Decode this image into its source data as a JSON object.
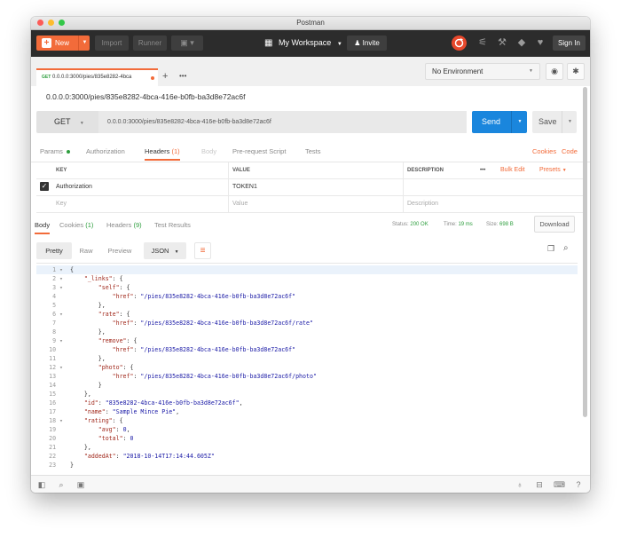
{
  "window": {
    "title": "Postman"
  },
  "header": {
    "new_label": "New",
    "import_label": "Import",
    "runner_label": "Runner",
    "workspace_label": "My Workspace",
    "invite_label": "Invite",
    "signin_label": "Sign In",
    "icons": [
      "sync-icon",
      "satellite-icon",
      "wrench-icon",
      "bell-icon",
      "heart-icon"
    ]
  },
  "request_tab": {
    "method": "GET",
    "label": "0.0.0.0:3000/pies/835e8282-4bca"
  },
  "environment": {
    "selected": "No Environment"
  },
  "request": {
    "title": "0.0.0.0:3000/pies/835e8282-4bca-416e-b0fb-ba3d8e72ac6f",
    "method": "GET",
    "url": "0.0.0.0:3000/pies/835e8282-4bca-416e-b0fb-ba3d8e72ac6f",
    "send_label": "Send",
    "save_label": "Save"
  },
  "request_tabs": {
    "params": "Params",
    "authorization": "Authorization",
    "headers": "Headers",
    "headers_count": "(1)",
    "body": "Body",
    "prerequest": "Pre-request Script",
    "tests": "Tests",
    "cookies": "Cookies",
    "code": "Code"
  },
  "headers_table": {
    "col_key": "KEY",
    "col_value": "VALUE",
    "col_description": "DESCRIPTION",
    "more": "•••",
    "bulk_edit": "Bulk Edit",
    "presets": "Presets",
    "row_key": "Authorization",
    "row_value": "TOKEN1",
    "placeholder_key": "Key",
    "placeholder_value": "Value",
    "placeholder_description": "Description"
  },
  "response": {
    "tabs": {
      "body": "Body",
      "cookies": "Cookies",
      "cookies_count": "(1)",
      "headers": "Headers",
      "headers_count": "(9)",
      "tests": "Test Results"
    },
    "status_label": "Status:",
    "status_value": "200 OK",
    "time_label": "Time:",
    "time_value": "19 ms",
    "size_label": "Size:",
    "size_value": "698 B",
    "download_label": "Download",
    "view": {
      "pretty": "Pretty",
      "raw": "Raw",
      "preview": "Preview",
      "format": "JSON"
    }
  },
  "code_lines": [
    {
      "n": "1",
      "fold": true,
      "parts": [
        [
          "p",
          "{"
        ]
      ]
    },
    {
      "n": "2",
      "fold": true,
      "parts": [
        [
          "p",
          "    "
        ],
        [
          "k",
          "\"_links\""
        ],
        [
          "p",
          ": {"
        ]
      ]
    },
    {
      "n": "3",
      "fold": true,
      "parts": [
        [
          "p",
          "        "
        ],
        [
          "k",
          "\"self\""
        ],
        [
          "p",
          ": {"
        ]
      ]
    },
    {
      "n": "4",
      "fold": false,
      "parts": [
        [
          "p",
          "            "
        ],
        [
          "k",
          "\"href\""
        ],
        [
          "p",
          ": "
        ],
        [
          "s",
          "\"/pies/835e8282-4bca-416e-b0fb-ba3d8e72ac6f\""
        ]
      ]
    },
    {
      "n": "5",
      "fold": false,
      "parts": [
        [
          "p",
          "        },"
        ]
      ]
    },
    {
      "n": "6",
      "fold": true,
      "parts": [
        [
          "p",
          "        "
        ],
        [
          "k",
          "\"rate\""
        ],
        [
          "p",
          ": {"
        ]
      ]
    },
    {
      "n": "7",
      "fold": false,
      "parts": [
        [
          "p",
          "            "
        ],
        [
          "k",
          "\"href\""
        ],
        [
          "p",
          ": "
        ],
        [
          "s",
          "\"/pies/835e8282-4bca-416e-b0fb-ba3d8e72ac6f/rate\""
        ]
      ]
    },
    {
      "n": "8",
      "fold": false,
      "parts": [
        [
          "p",
          "        },"
        ]
      ]
    },
    {
      "n": "9",
      "fold": true,
      "parts": [
        [
          "p",
          "        "
        ],
        [
          "k",
          "\"remove\""
        ],
        [
          "p",
          ": {"
        ]
      ]
    },
    {
      "n": "10",
      "fold": false,
      "parts": [
        [
          "p",
          "            "
        ],
        [
          "k",
          "\"href\""
        ],
        [
          "p",
          ": "
        ],
        [
          "s",
          "\"/pies/835e8282-4bca-416e-b0fb-ba3d8e72ac6f\""
        ]
      ]
    },
    {
      "n": "11",
      "fold": false,
      "parts": [
        [
          "p",
          "        },"
        ]
      ]
    },
    {
      "n": "12",
      "fold": true,
      "parts": [
        [
          "p",
          "        "
        ],
        [
          "k",
          "\"photo\""
        ],
        [
          "p",
          ": {"
        ]
      ]
    },
    {
      "n": "13",
      "fold": false,
      "parts": [
        [
          "p",
          "            "
        ],
        [
          "k",
          "\"href\""
        ],
        [
          "p",
          ": "
        ],
        [
          "s",
          "\"/pies/835e8282-4bca-416e-b0fb-ba3d8e72ac6f/photo\""
        ]
      ]
    },
    {
      "n": "14",
      "fold": false,
      "parts": [
        [
          "p",
          "        }"
        ]
      ]
    },
    {
      "n": "15",
      "fold": false,
      "parts": [
        [
          "p",
          "    },"
        ]
      ]
    },
    {
      "n": "16",
      "fold": false,
      "parts": [
        [
          "p",
          "    "
        ],
        [
          "k",
          "\"id\""
        ],
        [
          "p",
          ": "
        ],
        [
          "s",
          "\"835e8282-4bca-416e-b0fb-ba3d8e72ac6f\""
        ],
        [
          "p",
          ","
        ]
      ]
    },
    {
      "n": "17",
      "fold": false,
      "parts": [
        [
          "p",
          "    "
        ],
        [
          "k",
          "\"name\""
        ],
        [
          "p",
          ": "
        ],
        [
          "s",
          "\"Sample Mince Pie\""
        ],
        [
          "p",
          ","
        ]
      ]
    },
    {
      "n": "18",
      "fold": true,
      "parts": [
        [
          "p",
          "    "
        ],
        [
          "k",
          "\"rating\""
        ],
        [
          "p",
          ": {"
        ]
      ]
    },
    {
      "n": "19",
      "fold": false,
      "parts": [
        [
          "p",
          "        "
        ],
        [
          "k",
          "\"avg\""
        ],
        [
          "p",
          ": "
        ],
        [
          "n",
          "0"
        ],
        [
          "p",
          ","
        ]
      ]
    },
    {
      "n": "20",
      "fold": false,
      "parts": [
        [
          "p",
          "        "
        ],
        [
          "k",
          "\"total\""
        ],
        [
          "p",
          ": "
        ],
        [
          "n",
          "0"
        ]
      ]
    },
    {
      "n": "21",
      "fold": false,
      "parts": [
        [
          "p",
          "    },"
        ]
      ]
    },
    {
      "n": "22",
      "fold": false,
      "parts": [
        [
          "p",
          "    "
        ],
        [
          "k",
          "\"addedAt\""
        ],
        [
          "p",
          ": "
        ],
        [
          "s",
          "\"2018-10-14T17:14:44.605Z\""
        ]
      ]
    },
    {
      "n": "23",
      "fold": false,
      "parts": [
        [
          "p",
          "}"
        ]
      ]
    }
  ],
  "colors": {
    "accent": "#f26b3a",
    "send": "#1a86dd",
    "status_ok": "#2e9e3e",
    "key": "#a1291c",
    "string": "#1a1aa6"
  }
}
